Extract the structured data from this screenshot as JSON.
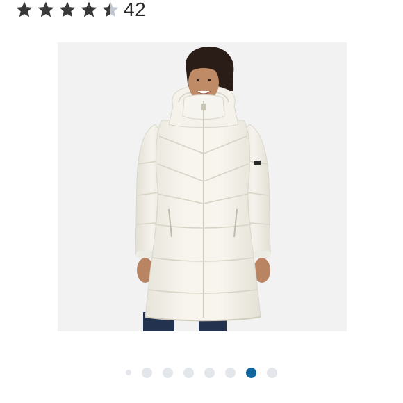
{
  "rating": {
    "stars_value": 4.5,
    "stars_max": 5,
    "count": "42",
    "star_color": "#3a3a3a",
    "star_empty_color": "#bfc6cf"
  },
  "product_image": {
    "subject": "woman-in-white-long-puffer-coat",
    "background_color": "#f2f2f3",
    "coat_color": "#f4f2ea"
  },
  "carousel": {
    "total": 8,
    "active_index": 6,
    "active_color": "#10659c",
    "inactive_color": "#e3e6ea"
  }
}
